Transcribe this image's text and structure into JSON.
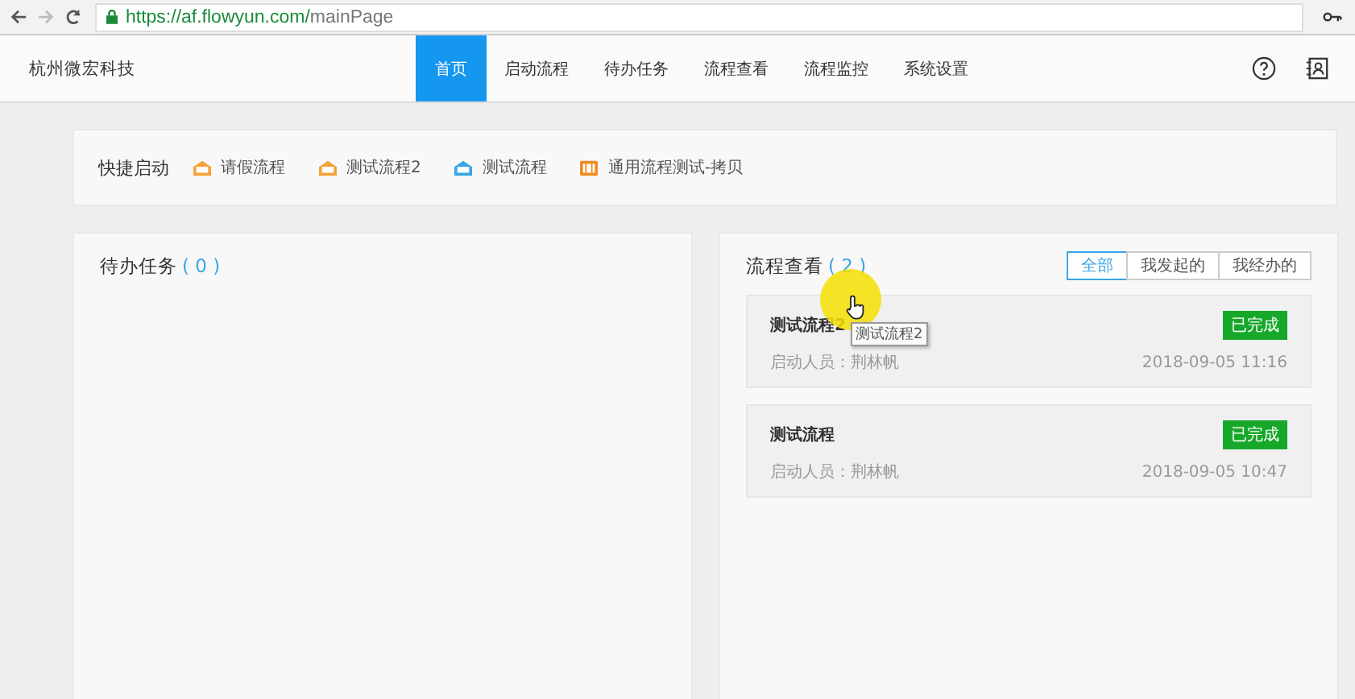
{
  "browser": {
    "url_host": "https://af.flowyun.com/",
    "url_path": "mainPage"
  },
  "nav": {
    "brand": "杭州微宏科技",
    "items": [
      {
        "label": "首页",
        "selected": true
      },
      {
        "label": "启动流程",
        "selected": false
      },
      {
        "label": "待办任务",
        "selected": false
      },
      {
        "label": "流程查看",
        "selected": false
      },
      {
        "label": "流程监控",
        "selected": false
      },
      {
        "label": "系统设置",
        "selected": false
      }
    ]
  },
  "quick_start": {
    "title": "快捷启动",
    "items": [
      {
        "label": "请假流程",
        "color": "#f5a23a"
      },
      {
        "label": "测试流程2",
        "color": "#f5a23a"
      },
      {
        "label": "测试流程",
        "color": "#3aa5e8"
      },
      {
        "label": "通用流程测试-拷贝",
        "color": "#f08a24",
        "kind": "form"
      }
    ]
  },
  "todo": {
    "title": "待办任务",
    "count": "( 0 )"
  },
  "flows": {
    "title": "流程查看",
    "count": "( 2 )",
    "filters": [
      {
        "label": "全部",
        "selected": true
      },
      {
        "label": "我发起的",
        "selected": false
      },
      {
        "label": "我经办的",
        "selected": false
      }
    ],
    "items": [
      {
        "name": "测试流程2",
        "status": "已完成",
        "starter": "启动人员：荆林帆",
        "time": "2018-09-05 11:16",
        "tooltip": "测试流程2"
      },
      {
        "name": "测试流程",
        "status": "已完成",
        "starter": "启动人员：荆林帆",
        "time": "2018-09-05 10:47"
      }
    ]
  }
}
